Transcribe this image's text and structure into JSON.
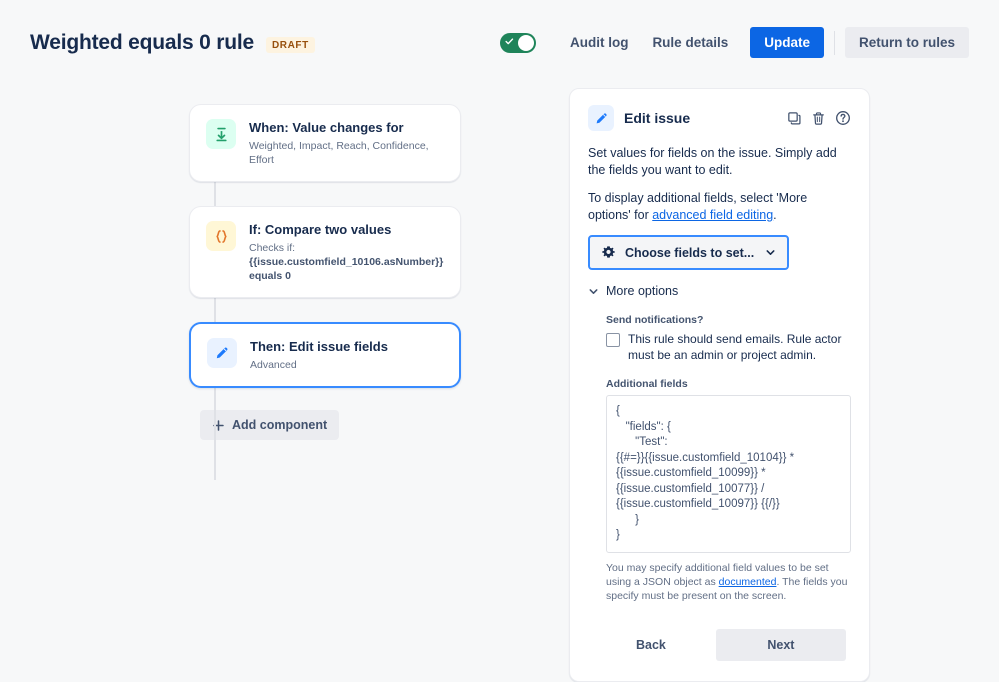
{
  "header": {
    "rule_title": "Weighted equals 0 rule",
    "status_badge": "DRAFT",
    "toggle_enabled_icon": "check-icon",
    "audit_log_label": "Audit log",
    "rule_details_label": "Rule details",
    "update_label": "Update",
    "return_label": "Return to rules",
    "accent_color": "#0c66e4",
    "toggle_color": "#1f845a",
    "badge_color": "#974f0c",
    "badge_bg": "#fdf3e0"
  },
  "flow": {
    "cards": [
      {
        "icon": "value-change-icon",
        "title": "When: Value changes for",
        "subtitle": "Weighted, Impact, Reach, Confidence, Effort",
        "subtitle2": ""
      },
      {
        "icon": "curly-braces-icon",
        "title": "If: Compare two values",
        "subtitle": "Checks if:",
        "subtitle2": "{{issue.customfield_10106.asNumber}} equals 0"
      },
      {
        "icon": "pencil-icon",
        "title": "Then: Edit issue fields",
        "subtitle": "Advanced",
        "subtitle2": ""
      }
    ],
    "add_component_label": "Add component",
    "add_component_icon": "plus-icon"
  },
  "panel": {
    "icon": "pencil-icon",
    "title": "Edit issue",
    "actions": [
      {
        "name": "duplicate-icon",
        "label": "Duplicate"
      },
      {
        "name": "trash-icon",
        "label": "Delete"
      },
      {
        "name": "help-icon",
        "label": "Help"
      }
    ],
    "description_1": "Set values for fields on the issue. Simply add the fields you want to edit.",
    "description_2_before": "To display additional fields, select 'More options' for ",
    "description_2_link": "advanced field editing",
    "description_2_after": ".",
    "choose_fields_label": "Choose fields to set...",
    "choose_fields_icon": "gear-icon",
    "choose_fields_chevron": "chevron-down-icon",
    "more_options_label": "More options",
    "more_options_chevron": "chevron-down-icon",
    "send_notifications_label": "Send notifications?",
    "send_notifications_checked": false,
    "send_notifications_text": "This rule should send emails. Rule actor must be an admin or project admin.",
    "additional_fields_label": "Additional fields",
    "additional_fields_value": "{\n   \"fields\": {\n      \"Test\":\n{{#=}}{{issue.customfield_10104}} *\n{{issue.customfield_10099}} *\n{{issue.customfield_10077}} /\n{{issue.customfield_10097}} {{/}}\n      }\n}",
    "help_text_before": "You may specify additional field values to be set using a JSON object as ",
    "help_text_link": "documented",
    "help_text_after": ". The fields you specify must be present on the screen.",
    "back_label": "Back",
    "next_label": "Next"
  }
}
